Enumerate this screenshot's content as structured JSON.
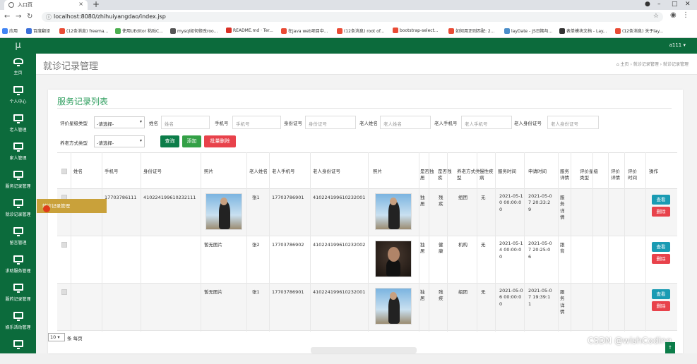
{
  "browser": {
    "tab_title": "入口页",
    "url": "localhost:8080/zhihuiyangdao/index.jsp",
    "bookmarks": [
      "应用",
      "百度翻译",
      "(12条消息) freema...",
      "使用UEditor 粘贴C...",
      "mysql如何修改roo...",
      "README.md · Ter...",
      "在java web项目中...",
      "(12条消息) root of...",
      "bootstrap-select...",
      "如何用正则匹配: 2...",
      "layDate - JS日期与...",
      "表单模块文档 - Lay...",
      "(12条消息) 关于lay..."
    ],
    "bookmark_colors": [
      "#4285f4",
      "#3b6fd8",
      "#e94b35",
      "#4caf50",
      "#555555",
      "#d93025",
      "#e94b35",
      "#e94b35",
      "#e94b35",
      "#e94b35",
      "#4b8ec9",
      "#333333",
      "#e94b35"
    ]
  },
  "sidebar": {
    "logo": "μ",
    "items": [
      {
        "label": "主页",
        "icon": "dashboard-icon"
      },
      {
        "label": "个人中心",
        "icon": "monitor-icon"
      },
      {
        "label": "老人管理",
        "icon": "monitor-icon"
      },
      {
        "label": "家人管理",
        "icon": "monitor-icon"
      },
      {
        "label": "服务记录管理",
        "icon": "monitor-icon"
      },
      {
        "label": "就诊记录管理",
        "icon": "monitor-icon"
      },
      {
        "label": "留言管理",
        "icon": "monitor-icon"
      },
      {
        "label": "求助服务管理",
        "icon": "monitor-icon"
      },
      {
        "label": "服药记录管理",
        "icon": "monitor-icon"
      },
      {
        "label": "娱乐活动管理",
        "icon": "monitor-icon"
      }
    ]
  },
  "topbar": {
    "user": "a111 ▾"
  },
  "page": {
    "title": "就诊记录管理",
    "breadcrumb": "⌂ 主页 › 就诊记录管理 › 就诊记录管理",
    "panel_title": "服务记录列表"
  },
  "filters": {
    "eval_type_label": "评价星级类型",
    "eval_type_value": "-请选择-",
    "name_label": "姓名",
    "name_placeholder": "姓名",
    "phone_label": "手机号",
    "phone_placeholder": "手机号",
    "id_label": "身份证号",
    "id_placeholder": "身份证号",
    "elder_name_label": "老人姓名",
    "elder_name_placeholder": "老人姓名",
    "elder_phone_label": "老人手机号",
    "elder_phone_placeholder": "老人手机号",
    "elder_id_label": "老人身份证号",
    "elder_id_placeholder": "老人身份证号",
    "care_type_label": "养老方式类型",
    "care_type_value": "-请选择-",
    "btn_query": "查询",
    "btn_add": "添加",
    "btn_batch_delete": "批量删除"
  },
  "table": {
    "headers": [
      "姓名",
      "手机号",
      "身份证号",
      "照片",
      "老人姓名",
      "老人手机号",
      "老人身份证号",
      "照片",
      "是否独居",
      "是否残疾",
      "养老方式类型",
      "慢性疾病",
      "服务时间",
      "申请时间",
      "服务详情",
      "评价星级类型",
      "评价详情",
      "评价时间",
      "操作"
    ],
    "rows": [
      {
        "name": "",
        "phone": "17703786111",
        "id": "410224199610232111",
        "photo": "image",
        "elder_name": "张1",
        "elder_phone": "17703786901",
        "elder_id": "410224199610232001",
        "elder_photo": "image",
        "alone": "独居",
        "disabled": "残疾",
        "care_type": "组团",
        "chronic": "无",
        "service_time": "2021-05-10 00:00:00",
        "apply_time": "2021-05-07 20:33:29",
        "detail": "服务详情",
        "rating_type": "",
        "rating_detail": "",
        "rating_time": ""
      },
      {
        "name": "",
        "phone": "",
        "id": "",
        "photo": "暂无图片",
        "elder_name": "张2",
        "elder_phone": "17703786902",
        "elder_id": "410224199610232002",
        "elder_photo": "image",
        "alone": "独居",
        "disabled": "健康",
        "care_type": "机构",
        "chronic": "无",
        "service_time": "2021-05-14 00:00:00",
        "apply_time": "2021-05-07 20:25:06",
        "detail": "跟背",
        "rating_type": "",
        "rating_detail": "",
        "rating_time": ""
      },
      {
        "name": "",
        "phone": "",
        "id": "",
        "photo": "暂无图片",
        "elder_name": "张1",
        "elder_phone": "17703786901",
        "elder_id": "410224199610232001",
        "elder_photo": "image",
        "alone": "独居",
        "disabled": "残疾",
        "care_type": "组团",
        "chronic": "无",
        "service_time": "2021-05-06 00:00:00",
        "apply_time": "2021-05-07 19:39:11",
        "detail": "服务详情",
        "rating_type": "",
        "rating_detail": "",
        "rating_time": ""
      }
    ],
    "action_view": "查看",
    "action_delete": "删除"
  },
  "pagination": {
    "page_size": "10 ▾",
    "label": "条 每页"
  },
  "tooltip": "就诊记录管理",
  "watermark": "CSDN @wishCoding",
  "scroll_top": "↑"
}
